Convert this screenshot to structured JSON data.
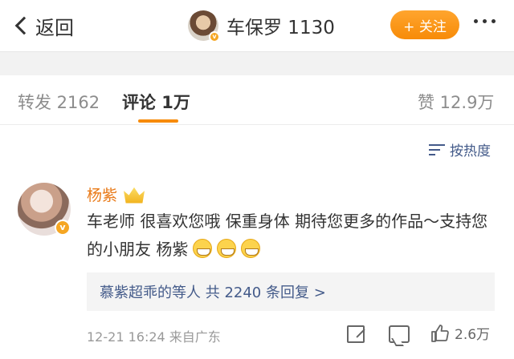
{
  "nav": {
    "back_label": "返回",
    "title": "车保罗 1130",
    "follow_label": "+ 关注"
  },
  "tabs": {
    "repost": "转发 2162",
    "comments": "评论 1万",
    "likes": "赞 12.9万"
  },
  "sort": {
    "label": "按热度"
  },
  "comment": {
    "author": "杨紫",
    "text": "车老师 很喜欢您哦 保重身体 期待您更多的作品～支持您的小朋友 杨紫",
    "emoji_count": 3,
    "replies_summary": "慕紫超乖的等人  共 2240 条回复 >",
    "time_source": "12-21 16:24  来自广东",
    "like_count": "2.6万"
  },
  "colors": {
    "accent_orange": "#f78b08",
    "link_blue": "#445b8a",
    "author_orange": "#e97a18"
  }
}
